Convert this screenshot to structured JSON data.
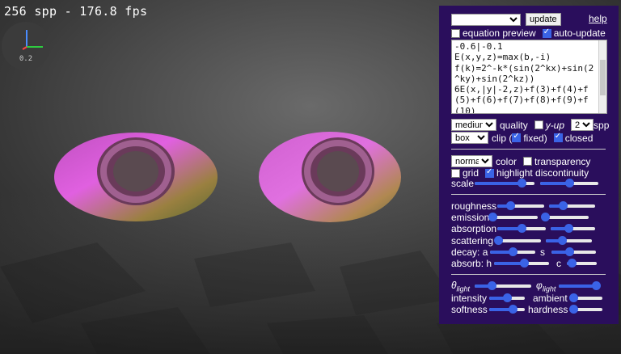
{
  "overlay": {
    "fps_text": "256 spp - 176.8 fps",
    "gizmo_scale": "0.2"
  },
  "panel": {
    "preset_select_value": "",
    "update_label": "update",
    "help_label": "help",
    "equation_preview_label": "equation preview",
    "equation_preview_checked": false,
    "auto_update_label": "auto-update",
    "auto_update_checked": true,
    "equation_lines": [
      "-0.6|-0.1",
      "E(x,y,z)=max(b,-i)",
      "f(k)=2^-k*(sin(2^kx)+sin(2",
      "^ky)+sin(2^kz))",
      "6E(x,|y|-2,z)+f(3)+f(4)+f",
      "(5)+f(6)+f(7)+f(8)+f(9)+f",
      "(10)"
    ],
    "quality_value": "medium",
    "quality_label": "quality",
    "yup_label": "y-up",
    "yup_checked": false,
    "spp_value": "2⁸",
    "spp_label": "spp",
    "clip_value": "box",
    "clip_label": "clip (",
    "fixed_label": "fixed)",
    "fixed_checked": true,
    "closed_label": "closed",
    "closed_checked": true,
    "color_value": "normal",
    "color_label": "color",
    "transparency_label": "transparency",
    "transparency_checked": false,
    "grid_label": "grid",
    "grid_checked": false,
    "highlight_label": "highlight discontinuity",
    "highlight_checked": true,
    "scale_label": "scale",
    "roughness_label": "roughness",
    "emission_label": "emission",
    "absorption_label": "absorption",
    "scattering_label": "scattering",
    "decay_label": "decay: a",
    "decay_s_label": "s",
    "absorb_label": "absorb: h",
    "absorb_c_label": "c",
    "theta_label": "θ",
    "phi_label": "φ",
    "light_sub": "light",
    "intensity_label": "intensity",
    "ambient_label": "ambient",
    "softness_label": "softness",
    "hardness_label": "hardness",
    "accent_color": "#3a63e6",
    "panel_color": "#2a0e5c"
  },
  "sliders": {
    "scale_1": 0.78,
    "scale_2": 0.5,
    "roughness_1": 0.28,
    "roughness_2": 0.3,
    "emission_1": 0.03,
    "emission_2": 0.05,
    "absorption_1": 0.5,
    "absorption_2": 0.4,
    "scattering_1": 0.05,
    "scattering_2": 0.35,
    "decay_a": 0.5,
    "decay_s": 0.4,
    "absorb_h": 0.55,
    "absorb_c": 0.15,
    "theta_light": 0.3,
    "phi_light": 0.92,
    "intensity": 0.5,
    "ambient": 0.1,
    "softness": 0.65,
    "hardness": 0.1
  }
}
